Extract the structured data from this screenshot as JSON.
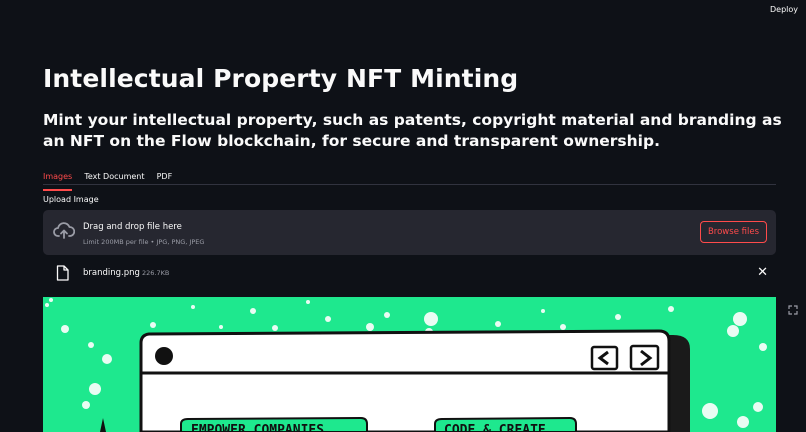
{
  "header": {
    "deploy_label": "Deploy"
  },
  "page": {
    "title": "Intellectual Property NFT Minting",
    "subtitle": "Mint your intellectual property, such as patents, copyright material and branding as an NFT on the Flow blockchain, for secure and transparent ownership."
  },
  "tabs": [
    {
      "label": "Images",
      "active": true
    },
    {
      "label": "Text Document",
      "active": false
    },
    {
      "label": "PDF",
      "active": false
    }
  ],
  "uploader": {
    "label": "Upload Image",
    "dropzone_title": "Drag and drop file here",
    "dropzone_hint": "Limit 200MB per file • JPG, PNG, JPEG",
    "browse_label": "Browse files",
    "icon": "cloud-upload-icon"
  },
  "uploaded_file": {
    "name": "branding.png",
    "size": "226.7KB",
    "icon": "file-icon"
  },
  "image_preview": {
    "background_color": "#1ee88e",
    "left_banner_text": "EMPOWER COMPANIES",
    "right_banner_text": "CODE & CREATE"
  },
  "colors": {
    "background": "#0e1117",
    "accent": "#ff4b4b",
    "surface": "#262730"
  }
}
